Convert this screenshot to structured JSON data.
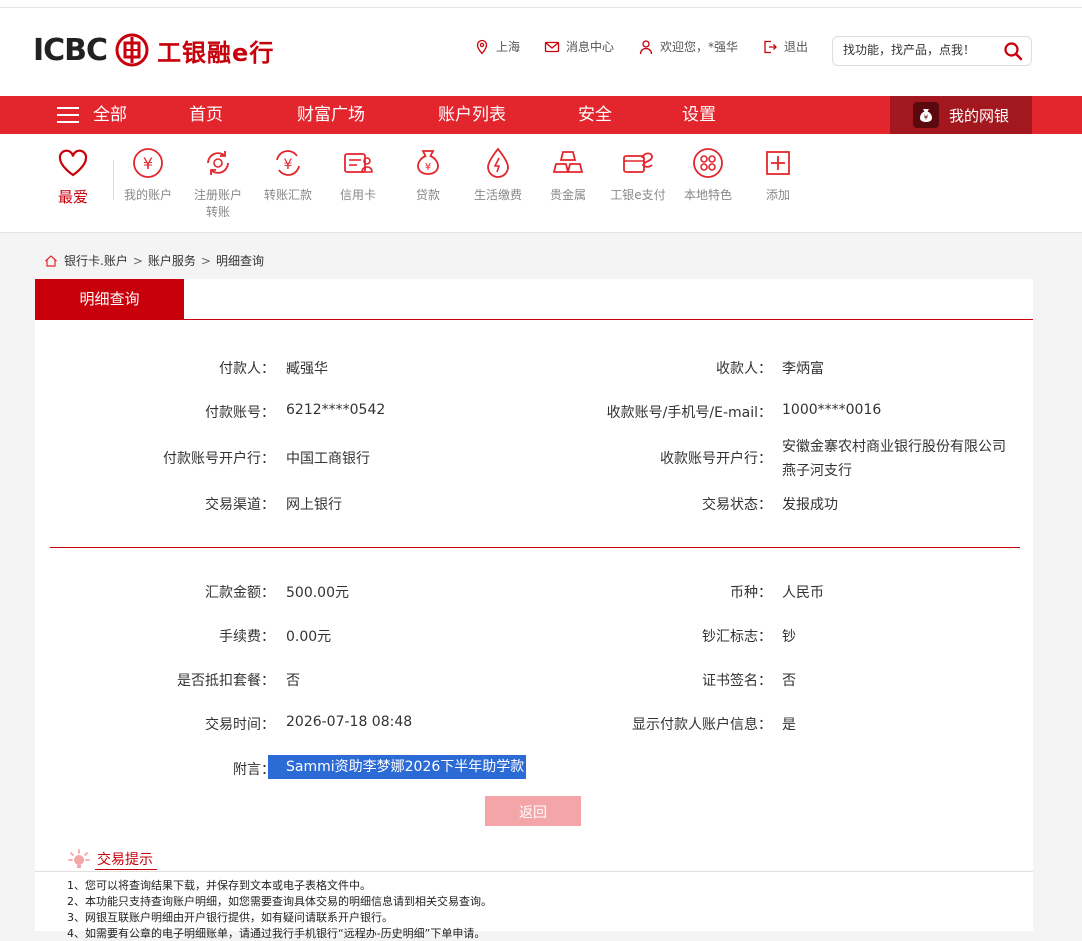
{
  "header": {
    "logo_text": "ICBC",
    "logo_cn": "工银融e行",
    "links": [
      {
        "icon": "location-pin-icon",
        "label": "上海"
      },
      {
        "icon": "mail-icon",
        "label": "消息中心"
      },
      {
        "icon": "user-icon",
        "label": "欢迎您，*强华"
      },
      {
        "icon": "logout-icon",
        "label": "退出"
      }
    ],
    "search_placeholder": "找功能，找产品，点我！"
  },
  "nav": {
    "all_label": "全部",
    "items": [
      "首页",
      "财富广场",
      "账户列表",
      "安全",
      "设置"
    ],
    "mybank_label": "我的网银"
  },
  "quick": {
    "fav_label": "最爱",
    "items": [
      {
        "icon": "my-account-icon",
        "label": "我的账户",
        "label2": ""
      },
      {
        "icon": "register-transfer-icon",
        "label": "注册账户",
        "label2": "转账"
      },
      {
        "icon": "transfer-icon",
        "label": "转账汇款",
        "label2": ""
      },
      {
        "icon": "credit-card-icon",
        "label": "信用卡",
        "label2": ""
      },
      {
        "icon": "loan-icon",
        "label": "贷款",
        "label2": ""
      },
      {
        "icon": "utility-payment-icon",
        "label": "生活缴费",
        "label2": ""
      },
      {
        "icon": "precious-metal-icon",
        "label": "贵金属",
        "label2": ""
      },
      {
        "icon": "epay-icon",
        "label": "工银e支付",
        "label2": ""
      },
      {
        "icon": "local-feature-icon",
        "label": "本地特色",
        "label2": ""
      },
      {
        "icon": "add-icon",
        "label": "添加",
        "label2": ""
      }
    ]
  },
  "breadcrumb": [
    "银行卡.账户",
    "账户服务",
    "明细查询"
  ],
  "tab_title": "明细查询",
  "details": {
    "payer_label": "付款人：",
    "payer": "臧强华",
    "payee_label": "收款人：",
    "payee": "李炳富",
    "payer_acct_label": "付款账号：",
    "payer_acct": "6212****0542",
    "payee_acct_label": "收款账号/手机号/E-mail：",
    "payee_acct": "1000****0016",
    "payer_bank_label": "付款账号开户行：",
    "payer_bank": "中国工商银行",
    "payee_bank_label": "收款账号开户行：",
    "payee_bank_1": "安徽金寨农村商业银行股份有限公司",
    "payee_bank_2": "燕子河支行",
    "channel_label": "交易渠道：",
    "channel": "网上银行",
    "status_label": "交易状态：",
    "status": "发报成功",
    "amount_label": "汇款金额：",
    "amount": "500.00元",
    "currency_label": "币种：",
    "currency": "人民币",
    "fee_label": "手续费：",
    "fee": "0.00元",
    "cash_flag_label": "钞汇标志：",
    "cash_flag": "钞",
    "package_label": "是否抵扣套餐：",
    "package": "否",
    "cert_label": "证书签名：",
    "cert": "否",
    "time_label": "交易时间：",
    "time": "2026-07-18 08:48",
    "show_info_label": "显示付款人账户信息：",
    "show_info": "是",
    "note_label": "附言：",
    "note": "Sammi资助李梦娜2026下半年助学款"
  },
  "back_label": "返回",
  "tips": {
    "title": "交易提示",
    "lines": [
      "1、您可以将查询结果下载，并保存到文本或电子表格文件中。",
      "2、本功能只支持查询账户明细，如您需要查询具体交易的明细信息请到相关交易查询。",
      "3、网银互联账户明细由开户银行提供，如有疑问请联系开户银行。",
      "4、如需要有公章的电子明细账单，请通过我行手机银行“远程办-历史明细”下单申请。"
    ]
  },
  "colors": {
    "brand_red": "#c7000b",
    "nav_red": "#e3262d",
    "mybank_dark": "#a3181e",
    "selection_blue": "#2c6ad6"
  }
}
